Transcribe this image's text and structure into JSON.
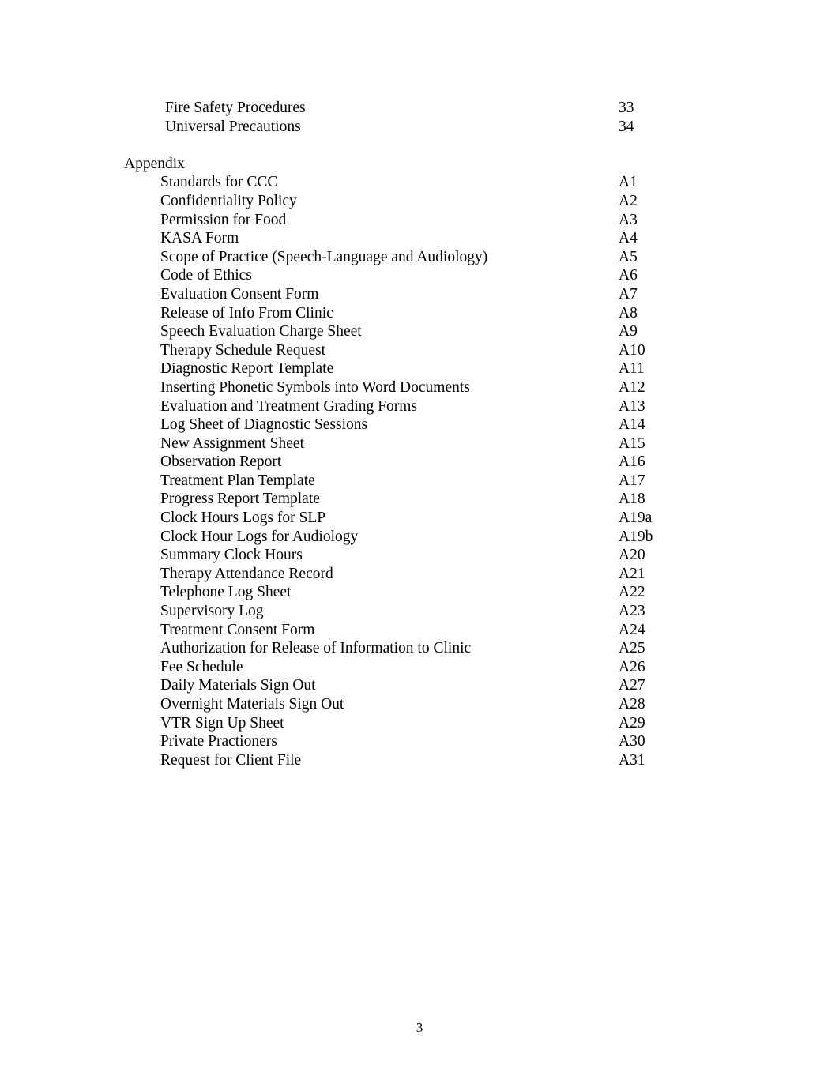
{
  "document": {
    "page_number": "3",
    "lead_entries": [
      {
        "title": "Fire Safety Procedures",
        "page": "33"
      },
      {
        "title": "Universal Precautions",
        "page": "34"
      }
    ],
    "appendix": {
      "heading": "Appendix",
      "entries": [
        {
          "title": "Standards for CCC",
          "page": "A1"
        },
        {
          "title": "Confidentiality Policy",
          "page": "A2"
        },
        {
          "title": "Permission for Food",
          "page": "A3"
        },
        {
          "title": "KASA Form",
          "page": "A4"
        },
        {
          "title": "Scope of Practice (Speech-Language and Audiology)",
          "page": "A5"
        },
        {
          "title": "Code of Ethics",
          "page": "A6"
        },
        {
          "title": "Evaluation Consent Form",
          "page": "A7"
        },
        {
          "title": "Release of Info From Clinic",
          "page": "A8"
        },
        {
          "title": "Speech Evaluation Charge Sheet",
          "page": "A9"
        },
        {
          "title": "Therapy Schedule Request",
          "page": "A10"
        },
        {
          "title": "Diagnostic Report Template",
          "page": "A11"
        },
        {
          "title": "Inserting Phonetic Symbols into Word Documents",
          "page": "A12"
        },
        {
          "title": "Evaluation and Treatment Grading Forms",
          "page": "A13"
        },
        {
          "title": "Log Sheet of Diagnostic Sessions",
          "page": "A14"
        },
        {
          "title": "New Assignment Sheet",
          "page": "A15"
        },
        {
          "title": "Observation Report",
          "page": "A16"
        },
        {
          "title": "Treatment Plan Template",
          "page": "A17"
        },
        {
          "title": "Progress Report Template",
          "page": "A18"
        },
        {
          "title": "Clock Hours Logs for SLP",
          "page": "A19a"
        },
        {
          "title": "Clock Hour Logs for Audiology",
          "page": "A19b"
        },
        {
          "title": "Summary Clock Hours",
          "page": "A20"
        },
        {
          "title": "Therapy Attendance Record",
          "page": "A21"
        },
        {
          "title": "Telephone Log Sheet",
          "page": "A22"
        },
        {
          "title": "Supervisory Log",
          "page": "A23"
        },
        {
          "title": "Treatment Consent Form",
          "page": "A24"
        },
        {
          "title": "Authorization for Release of Information to Clinic",
          "page": "A25"
        },
        {
          "title": "Fee Schedule",
          "page": "A26"
        },
        {
          "title": "Daily Materials Sign Out",
          "page": "A27"
        },
        {
          "title": "Overnight Materials Sign Out",
          "page": "A28"
        },
        {
          "title": "VTR Sign Up Sheet",
          "page": "A29"
        },
        {
          "title": "Private Practioners",
          "page": "A30"
        },
        {
          "title": "Request for Client File",
          "page": "A31"
        }
      ]
    }
  }
}
